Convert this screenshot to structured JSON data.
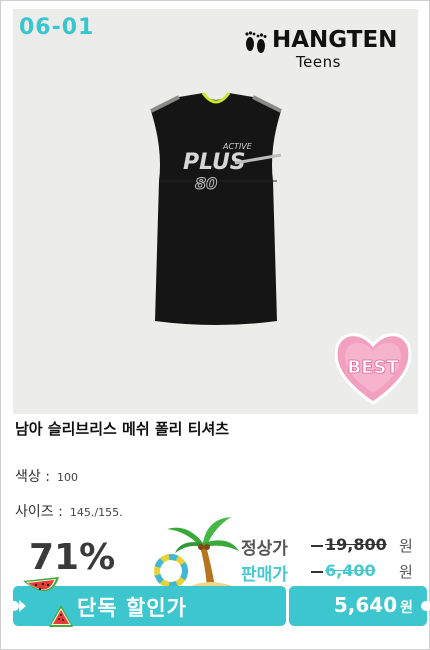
{
  "product": {
    "code": "06-01",
    "brand_name": "HANGTEN",
    "brand_sub": "Teens",
    "shirt_text_top": "ACTIVE",
    "shirt_text_main": "PLUS",
    "shirt_text_num": "80",
    "badge": "BEST",
    "title": "남아 슬리브리스 메쉬 폴리 티셔츠",
    "color_label": "색상 :",
    "color_value": "100",
    "size_label": "사이즈 :",
    "size_value": "145./155.",
    "discount": "71%",
    "regular_label": "정상가",
    "regular_price": "19,800",
    "sale_label": "판매가",
    "sale_price": "6,400",
    "currency": "원",
    "exclusive_label": "단독 할인가",
    "exclusive_price": "5,640",
    "exclusive_currency": "원"
  },
  "colors": {
    "accent": "#3ec6cf",
    "badge_pink": "#f08fb3",
    "shirt": "#151515"
  }
}
